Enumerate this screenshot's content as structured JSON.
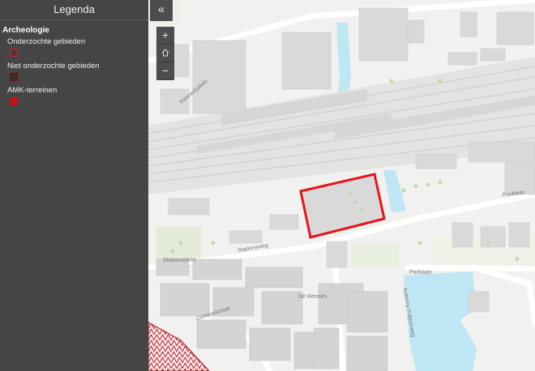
{
  "legend": {
    "title": "Legenda",
    "section_title": "Archeologie",
    "items": [
      {
        "label": "Onderzochte gebieden",
        "swatch": "outline-red"
      },
      {
        "label": "Niet onderzochte gebieden",
        "swatch": "outline-dark"
      },
      {
        "label": "AMK-terreinen",
        "swatch": "fill-red"
      }
    ]
  },
  "controls": {
    "collapse_icon": "double-chevron-left-icon",
    "collapse_glyph": "«",
    "zoom_in": "+",
    "home_icon": "home-icon",
    "zoom_out": "−"
  },
  "map": {
    "street_labels": {
      "stationsplein": "Stationsplein",
      "stationsweg": "Stationsweg",
      "parklaan": "Parklaan",
      "fuutlaan": "Fuutlaan",
      "de_rennes": "De Rennes",
      "dommelstraat": "Dommelstraat",
      "kennedyplein": "Kennedyplein",
      "anthony_fokkerweg": "Anthony Fokkerweg"
    },
    "colors": {
      "highlight": "#e8141c",
      "water": "#bfe6f4",
      "building": "#d9d9d9",
      "amk_hatch": "#b30f1a"
    }
  }
}
